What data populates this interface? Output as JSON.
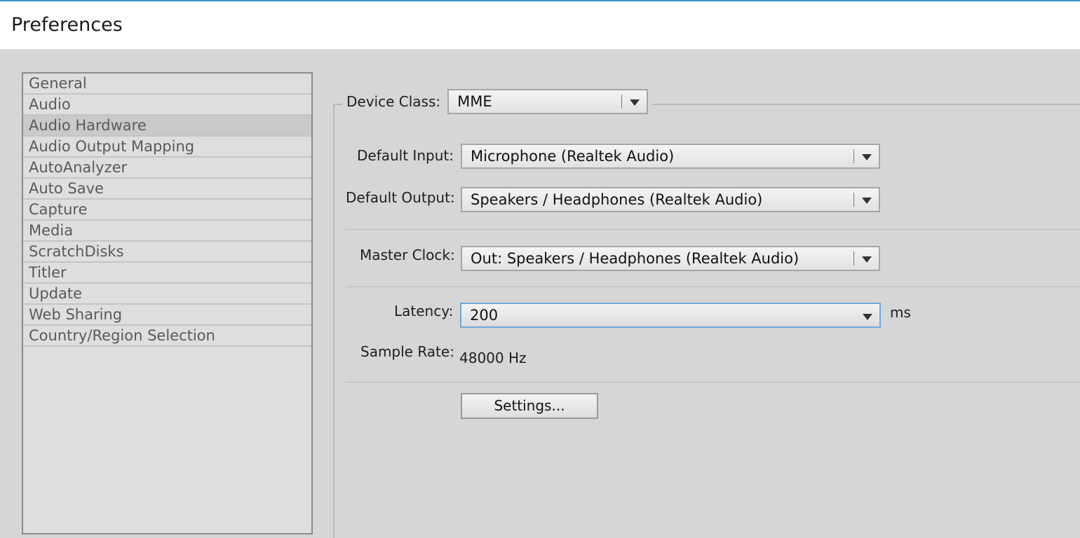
{
  "window": {
    "title": "Preferences"
  },
  "sidebar": {
    "items": [
      {
        "label": "General"
      },
      {
        "label": "Audio"
      },
      {
        "label": "Audio Hardware",
        "selected": true
      },
      {
        "label": "Audio Output Mapping"
      },
      {
        "label": "AutoAnalyzer"
      },
      {
        "label": "Auto Save"
      },
      {
        "label": "Capture"
      },
      {
        "label": "Media"
      },
      {
        "label": "ScratchDisks"
      },
      {
        "label": "Titler"
      },
      {
        "label": "Update"
      },
      {
        "label": "Web Sharing"
      },
      {
        "label": "Country/Region Selection"
      }
    ]
  },
  "audio_hardware": {
    "device_class": {
      "label": "Device Class:",
      "value": "MME"
    },
    "default_input": {
      "label": "Default Input:",
      "value": "Microphone (Realtek Audio)"
    },
    "default_output": {
      "label": "Default Output:",
      "value": "Speakers / Headphones (Realtek Audio)"
    },
    "master_clock": {
      "label": "Master Clock:",
      "value": "Out: Speakers / Headphones (Realtek Audio)"
    },
    "latency": {
      "label": "Latency:",
      "value": "200",
      "unit": "ms"
    },
    "sample_rate": {
      "label": "Sample Rate:",
      "value": "48000 Hz"
    },
    "settings_button": "Settings..."
  },
  "colors": {
    "title_accent": "#3c96c8",
    "focus_border": "#6fa8dc",
    "background": "#d6d6d6"
  }
}
